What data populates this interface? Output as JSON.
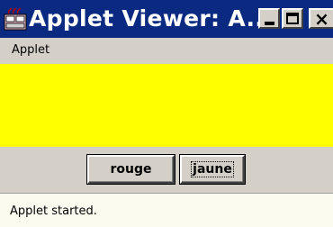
{
  "window": {
    "title": "Applet Viewer: A...",
    "icon": "java-applet-icon"
  },
  "titlebar_buttons": {
    "minimize": "minimize-icon",
    "maximize": "maximize-icon",
    "close": "close-icon"
  },
  "menu": {
    "items": [
      {
        "label": "Applet"
      }
    ]
  },
  "applet": {
    "background_color": "#ffff00",
    "buttons": [
      {
        "label": "rouge"
      },
      {
        "label": "jaune"
      }
    ],
    "focused_button": "jaune"
  },
  "status": {
    "text": "Applet started."
  },
  "colors": {
    "titlebar": "#0a2a82",
    "chrome": "#d4d0c8",
    "status_background": "#fbfbf0"
  }
}
